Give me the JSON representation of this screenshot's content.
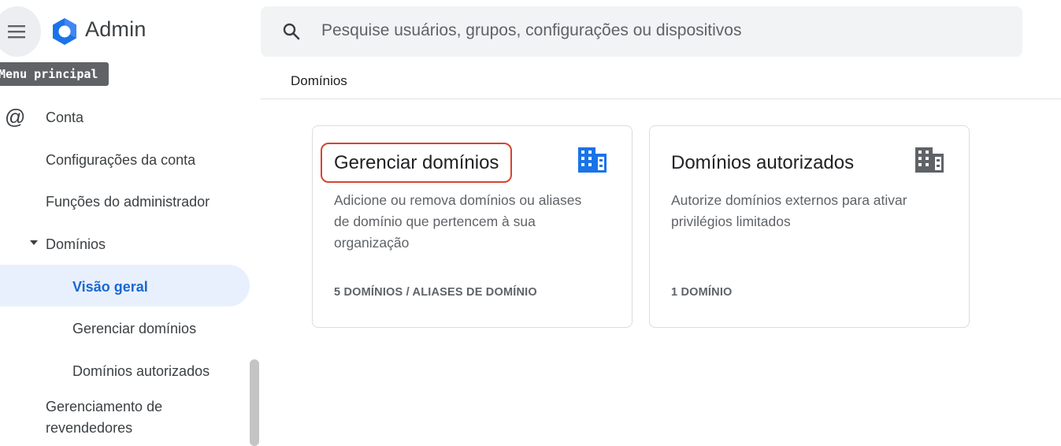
{
  "header": {
    "app_title": "Admin",
    "tooltip": "Menu principal",
    "logo": "google-admin-logo"
  },
  "search": {
    "placeholder": "Pesquise usuários, grupos, configurações ou dispositivos"
  },
  "breadcrumb": "Domínios",
  "sidebar": {
    "items": [
      {
        "label": "Conta",
        "icon": "at-icon"
      },
      {
        "label": "Configurações da conta"
      },
      {
        "label": "Funções do administrador"
      },
      {
        "label": "Domínios",
        "expanded": true
      },
      {
        "label": "Visão geral",
        "selected": true
      },
      {
        "label": "Gerenciar domínios"
      },
      {
        "label": "Domínios autorizados"
      },
      {
        "label": "Gerenciamento de"
      },
      {
        "label": "revendedores"
      }
    ]
  },
  "cards": [
    {
      "title": "Gerenciar domínios",
      "desc_lines": [
        "Adicione ou remova domínios ou aliases",
        "de domínio que pertencem à sua",
        "organização"
      ],
      "count": "5 DOMÍNIOS / ALIASES DE DOMÍNIO",
      "icon": "building-icon",
      "icon_color": "#1a73e8"
    },
    {
      "title": "Domínios autorizados",
      "desc_lines": [
        "Autorize domínios externos para ativar",
        "privilégios limitados"
      ],
      "count": "1 DOMÍNIO",
      "icon": "building-icon",
      "icon_color": "#5f6368"
    }
  ],
  "colors": {
    "accent": "#1967d2",
    "selected_bg": "#e8f0fe",
    "highlight": "#d6442f"
  }
}
